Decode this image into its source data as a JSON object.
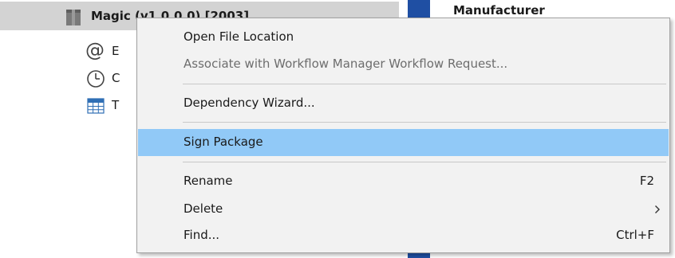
{
  "tree": {
    "package_label": "Magic (v1.0.0.0) [2003]",
    "children": [
      {
        "icon": "at-icon",
        "label": "E"
      },
      {
        "icon": "clock-icon",
        "label": "C"
      },
      {
        "icon": "table-icon",
        "label": "T"
      }
    ]
  },
  "details": {
    "column_header": "Manufacturer"
  },
  "context_menu": {
    "items": [
      {
        "label": "Open File Location",
        "shortcut": "",
        "disabled": false
      },
      {
        "label": "Associate with Workflow Manager Workflow Request...",
        "shortcut": "",
        "disabled": true
      },
      {
        "label": "Dependency Wizard...",
        "shortcut": "",
        "disabled": false
      },
      {
        "label": "Sign Package",
        "shortcut": "",
        "disabled": false,
        "highlighted": true
      },
      {
        "label": "Rename",
        "shortcut": "F2",
        "disabled": false
      },
      {
        "label": "Delete",
        "shortcut": "",
        "disabled": false,
        "submenu": true
      },
      {
        "label": "Find...",
        "shortcut": "Ctrl+F",
        "disabled": false
      }
    ]
  },
  "colors": {
    "highlight": "#91c9f7",
    "selection": "#d3d3d3",
    "accent": "#1f4fa3",
    "menu_bg": "#f2f2f2"
  }
}
